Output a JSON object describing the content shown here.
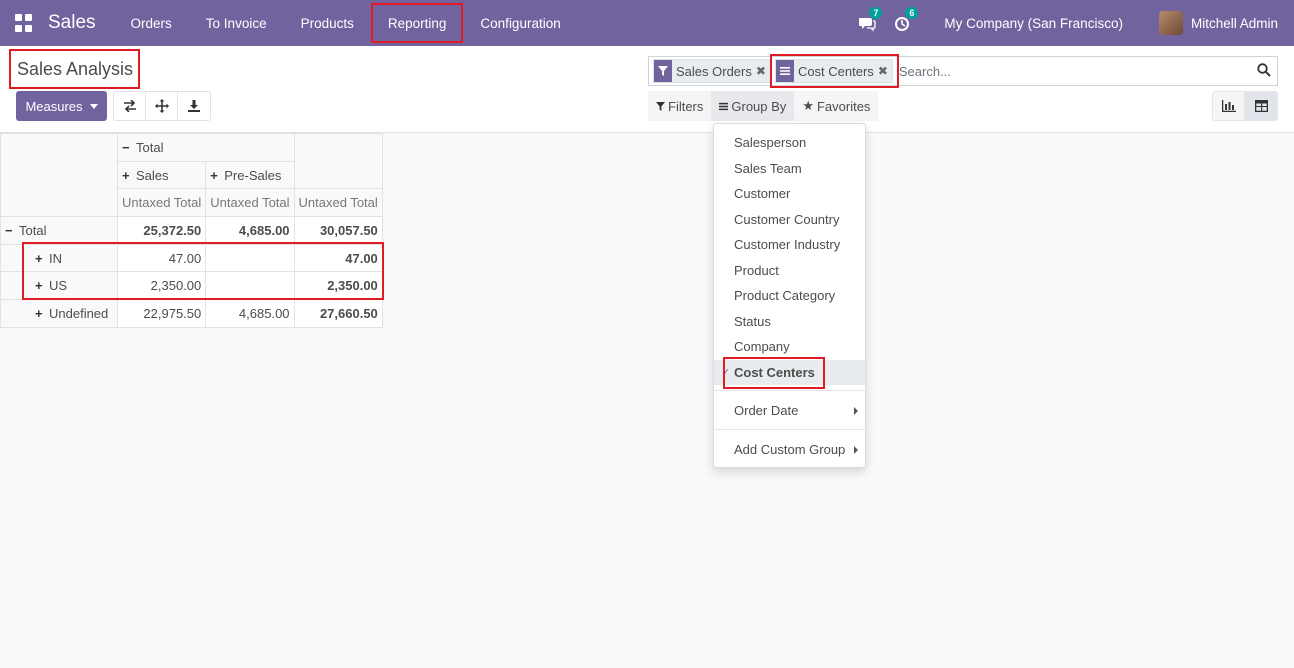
{
  "navbar": {
    "app_name": "Sales",
    "menu": [
      "Orders",
      "To Invoice",
      "Products",
      "Reporting",
      "Configuration"
    ],
    "messages_count": "7",
    "activities_count": "6",
    "company": "My Company (San Francisco)",
    "user": "Mitchell Admin"
  },
  "page": {
    "title": "Sales Analysis",
    "measures_label": "Measures"
  },
  "search": {
    "facets": [
      {
        "label": "Sales Orders",
        "icon": "filter-icon"
      },
      {
        "label": "Cost Centers",
        "icon": "group-by-icon"
      }
    ],
    "placeholder": "Search..."
  },
  "search_options": {
    "filters": "Filters",
    "group_by": "Group By",
    "favorites": "Favorites"
  },
  "group_by_menu": {
    "items": [
      "Salesperson",
      "Sales Team",
      "Customer",
      "Customer Country",
      "Customer Industry",
      "Product",
      "Product Category",
      "Status",
      "Company",
      "Cost Centers"
    ],
    "selected": "Cost Centers",
    "order_date": "Order Date",
    "add_custom_group": "Add Custom Group"
  },
  "pivot": {
    "col_total": "Total",
    "col_groups": [
      "Sales",
      "Pre-Sales"
    ],
    "measure": "Untaxed Total",
    "rows": [
      {
        "label": "Total",
        "values": [
          "25,372.50",
          "4,685.00",
          "30,057.50"
        ]
      },
      {
        "label": "IN",
        "values": [
          "47.00",
          "",
          "47.00"
        ]
      },
      {
        "label": "US",
        "values": [
          "2,350.00",
          "",
          "2,350.00"
        ]
      },
      {
        "label": "Undefined",
        "values": [
          "22,975.50",
          "4,685.00",
          "27,660.50"
        ]
      }
    ]
  },
  "colors": {
    "brand": "#71639e",
    "highlight": "#e01b24",
    "badge": "#00a09d"
  }
}
